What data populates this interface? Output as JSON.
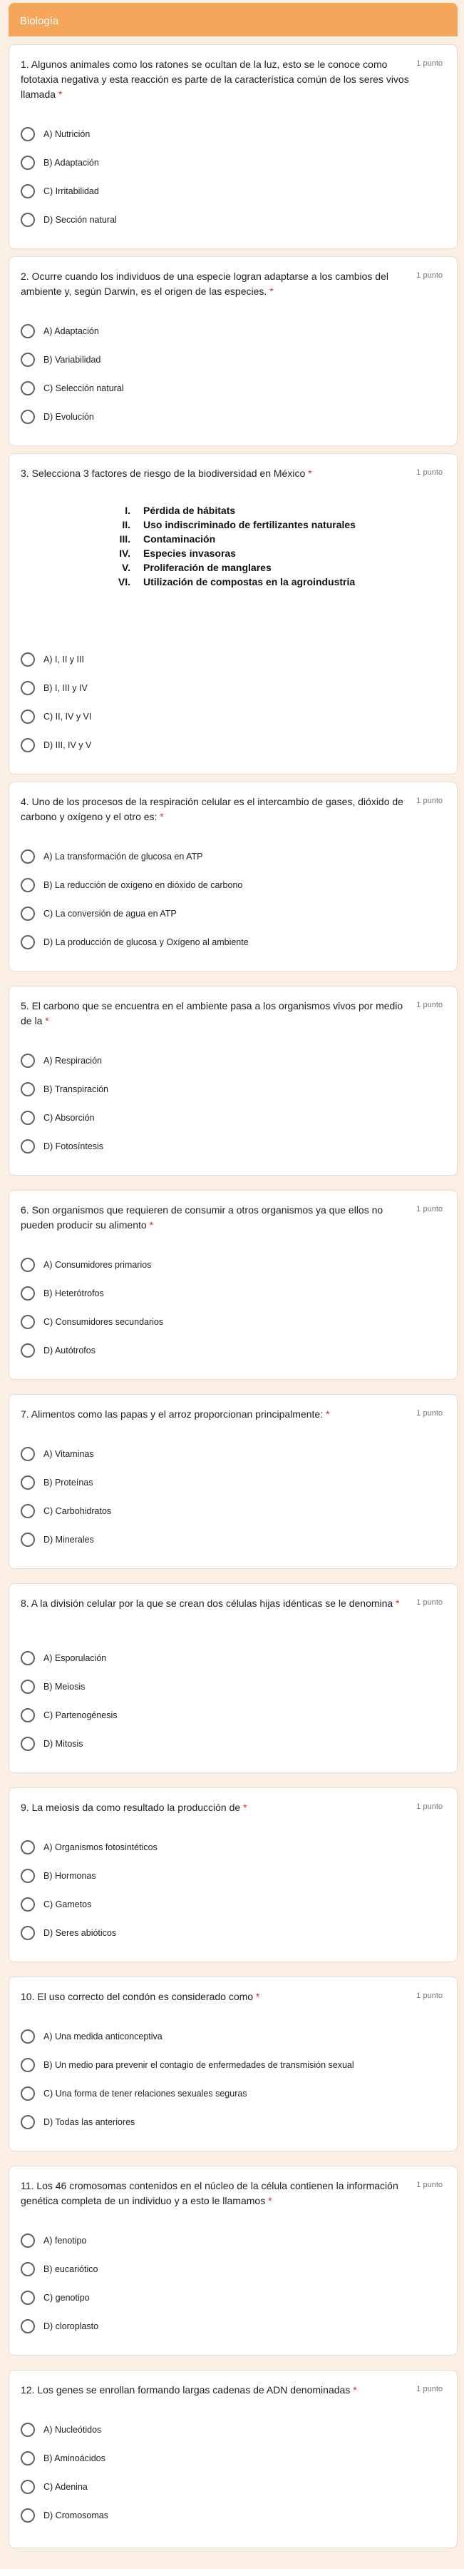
{
  "form": {
    "section_title": "Biología"
  },
  "questions": [
    {
      "title": "1. Algunos animales como los ratones se ocultan de la luz, esto se le conoce como fototaxia negativa y esta reacción es parte de la característica común de los seres vivos llamada",
      "required": "*",
      "points": "1 punto",
      "options": [
        "A) Nutrición",
        "B) Adaptación",
        "C) Irritabilidad",
        "D) Sección natural"
      ]
    },
    {
      "title": "2. Ocurre cuando los individuos de una especie logran adaptarse a los cambios del ambiente y, según Darwin, es el origen de las especies.",
      "required": "*",
      "points": "1 punto",
      "options": [
        "A) Adaptación",
        "B) Variabilidad",
        "C) Selección natural",
        "D) Evolución"
      ]
    },
    {
      "title": "3. Selecciona 3 factores de riesgo de la biodiversidad en México",
      "required": "*",
      "points": "1 punto",
      "factors": [
        {
          "num": "I.",
          "text": "Pérdida de hábitats"
        },
        {
          "num": "II.",
          "text": "Uso indiscriminado de fertilizantes naturales"
        },
        {
          "num": "III.",
          "text": "Contaminación"
        },
        {
          "num": "IV.",
          "text": "Especies invasoras"
        },
        {
          "num": "V.",
          "text": "Proliferación de manglares"
        },
        {
          "num": "VI.",
          "text": "Utilización de compostas en la agroindustria"
        }
      ],
      "options": [
        "A) I, II y III",
        "B) I, III y IV",
        "C) II, IV y VI",
        "D) III, IV y V"
      ]
    },
    {
      "title": "4. Uno de los procesos de la respiración celular es el intercambio de gases, dióxido de carbono y oxígeno y el otro es:",
      "required": "*",
      "points": "1 punto",
      "options": [
        "A) La transformación de glucosa en ATP",
        "B) La reducción de oxígeno en dióxido de carbono",
        "C) La conversión de agua en ATP",
        "D) La producción de glucosa y Oxígeno al ambiente"
      ]
    },
    {
      "title": "5. El carbono que se encuentra en el ambiente pasa a los organismos vivos por medio de la",
      "required": "*",
      "points": "1 punto",
      "options": [
        "A) Respiración",
        "B) Transpiración",
        "C) Absorción",
        "D) Fotosíntesis"
      ]
    },
    {
      "title": "6. Son organismos que requieren de consumir a otros organismos ya que ellos no pueden producir su alimento",
      "required": "*",
      "points": "1 punto",
      "options": [
        "A) Consumidores primarios",
        "B) Heterótrofos",
        "C) Consumidores secundarios",
        "D) Autótrofos"
      ]
    },
    {
      "title": "7. Alimentos como las papas y el arroz proporcionan principalmente:",
      "required": "*",
      "points": "1 punto",
      "options": [
        "A) Vitaminas",
        "B) Proteínas",
        "C) Carbohidratos",
        "D) Minerales"
      ]
    },
    {
      "title": "8. A la división celular por la que se crean dos células hijas idénticas se le denomina",
      "required": "*",
      "points": "1 punto",
      "options": [
        "A) Esporulación",
        "B) Meiosis",
        "C) Partenogénesis",
        "D) Mitosis"
      ]
    },
    {
      "title": "9. La meiosis da como resultado la producción de",
      "required": "*",
      "points": "1 punto",
      "options": [
        "A) Organismos fotosintéticos",
        "B) Hormonas",
        "C) Gametos",
        "D) Seres abióticos"
      ]
    },
    {
      "title": "10. El uso correcto del condón es considerado como",
      "required": "*",
      "points": "1 punto",
      "options": [
        "A) Una medida anticonceptiva",
        "B) Un medio para prevenir el contagio de enfermedades de transmisión sexual",
        "C) Una forma de tener relaciones sexuales seguras",
        "D) Todas las anteriores"
      ]
    },
    {
      "title": "11. Los 46 cromosomas contenidos en el núcleo de la célula contienen la información genética completa de un individuo y a esto le llamamos",
      "required": "*",
      "points": "1 punto",
      "options": [
        "A) fenotipo",
        "B) eucariótico",
        "C) genotipo",
        "D) cloroplasto"
      ]
    },
    {
      "title": "12. Los genes se enrollan formando largas cadenas de ADN denominadas",
      "required": "*",
      "points": "1 punto",
      "options": [
        "A) Nucleótidos",
        "B) Aminoácidos",
        "C) Adenina",
        "D) Cromosomas"
      ]
    }
  ]
}
